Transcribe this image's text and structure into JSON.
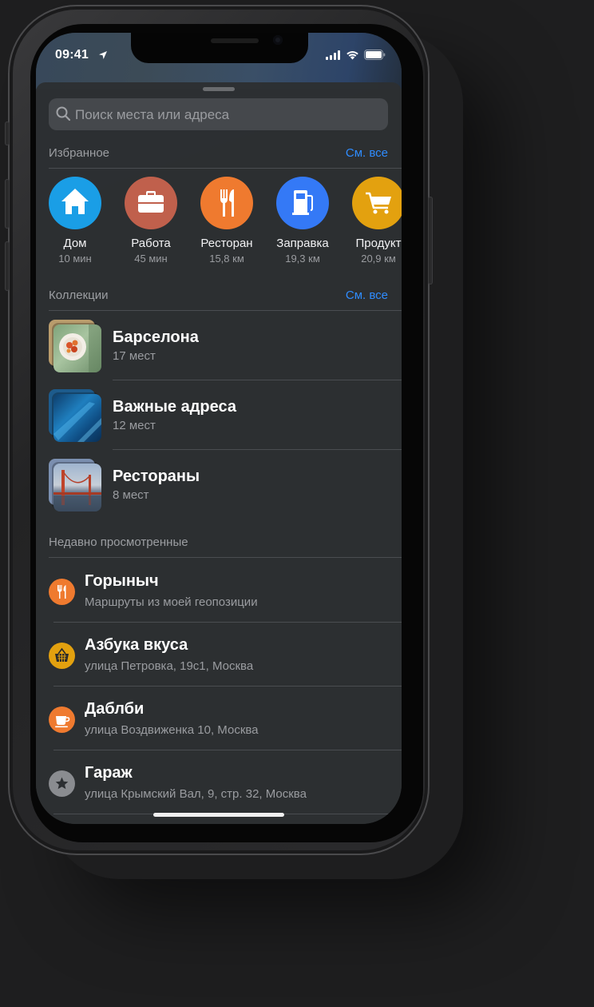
{
  "status_bar": {
    "time": "09:41"
  },
  "search": {
    "placeholder": "Поиск места или адреса"
  },
  "favorites": {
    "title": "Избранное",
    "see_all": "См. все",
    "items": [
      {
        "label": "Дом",
        "sub": "10 мин",
        "icon": "house-icon",
        "color": "#1a9ee6"
      },
      {
        "label": "Работа",
        "sub": "45 мин",
        "icon": "briefcase-icon",
        "color": "#c0604c"
      },
      {
        "label": "Ресторан",
        "sub": "15,8 км",
        "icon": "fork-knife-icon",
        "color": "#ef7a2f"
      },
      {
        "label": "Заправка",
        "sub": "19,3 км",
        "icon": "fuel-pump-icon",
        "color": "#3479f6"
      },
      {
        "label": "Продукт",
        "sub": "20,9 км",
        "icon": "shopping-cart-icon",
        "color": "#e3a10f"
      }
    ]
  },
  "collections": {
    "title": "Коллекции",
    "see_all": "См. все",
    "items": [
      {
        "title": "Барселона",
        "sub": "17 мест",
        "thumb": "food-photo"
      },
      {
        "title": "Важные адреса",
        "sub": "12 мест",
        "thumb": "blue-abstract-photo"
      },
      {
        "title": "Рестораны",
        "sub": "8 мест",
        "thumb": "bridge-photo"
      }
    ]
  },
  "recents": {
    "title": "Недавно просмотренные",
    "items": [
      {
        "title": "Горыныч",
        "sub": "Маршруты из моей геопозиции",
        "icon": "fork-knife-icon",
        "color": "#ef7a2f"
      },
      {
        "title": "Азбука вкуса",
        "sub": "улица Петровка, 19с1, Москва",
        "icon": "basket-icon",
        "color": "#e3a10f"
      },
      {
        "title": "Даблби",
        "sub": "улица Воздвиженка 10, Москва",
        "icon": "coffee-cup-icon",
        "color": "#ef7a2f"
      },
      {
        "title": "Гараж",
        "sub": "улица Крымский Вал, 9, стр. 32, Москва",
        "icon": "star-icon",
        "color": "#8a8c90"
      }
    ]
  },
  "colors": {
    "accent": "#2f8cff",
    "sheet": "#2c2f32"
  }
}
